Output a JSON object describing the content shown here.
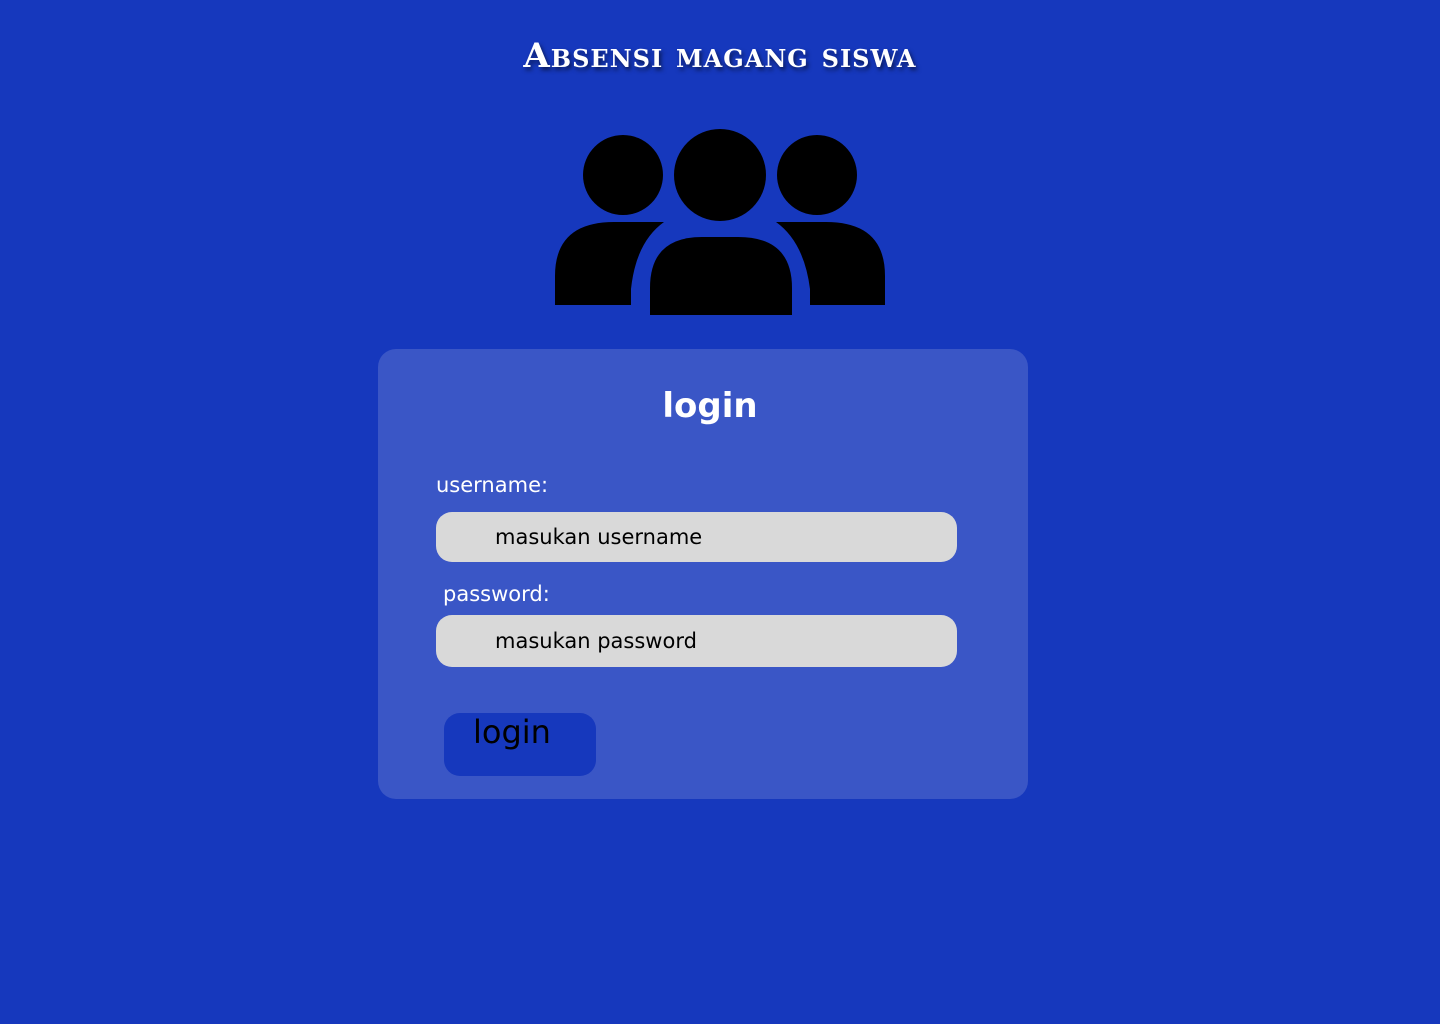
{
  "header": {
    "title": "Absensi magang siswa",
    "icon": "users-group-icon"
  },
  "login_form": {
    "title": "login",
    "username_label": "username:",
    "username_placeholder": "masukan username",
    "username_value": "",
    "password_label": "password:",
    "password_placeholder": "masukan password",
    "password_value": "",
    "submit_label": "login"
  },
  "colors": {
    "background": "#1638bd",
    "card": "#3a56c6",
    "input": "#d9d9d9",
    "button": "#1638bd",
    "icon": "#000000",
    "text_light": "#ffffff"
  }
}
